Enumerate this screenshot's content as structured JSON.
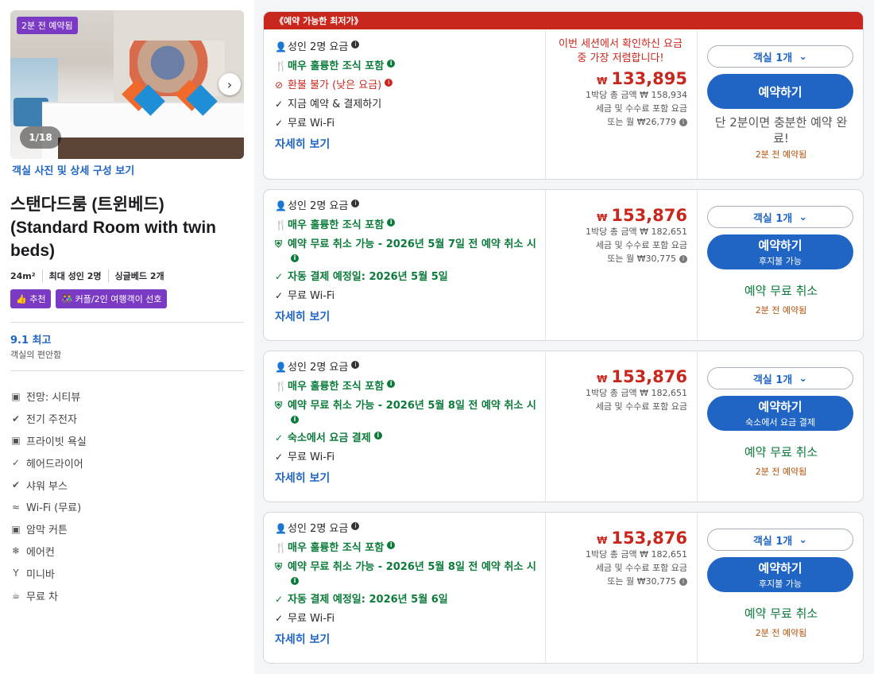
{
  "room": {
    "photo_badge": "2분 전 예약됨",
    "photo_count": "1/18",
    "photo_link": "객실 사진 및 상세 구성 보기",
    "title": "스탠다드룸 (트윈베드) (Standard Room with twin beds)",
    "specs": [
      "24m²",
      "최대 성인 2명",
      "싱글베드 2개"
    ],
    "tags": [
      "추천",
      "커플/2인 여행객이 선호"
    ],
    "rating": "9.1 최고",
    "rating_sub": "객실의 편안함",
    "amenities": [
      {
        "icon": "view-icon",
        "label": "전망: 시티뷰"
      },
      {
        "icon": "charger-icon",
        "label": "전기 주전자"
      },
      {
        "icon": "bathtub-icon",
        "label": "프라이빗 욕실"
      },
      {
        "icon": "check-icon",
        "label": "헤어드라이어"
      },
      {
        "icon": "shower-icon",
        "label": "샤워 부스"
      },
      {
        "icon": "wifi-icon",
        "label": "Wi-Fi (무료)"
      },
      {
        "icon": "curtain-icon",
        "label": "암막 커튼"
      },
      {
        "icon": "snowflake-icon",
        "label": "에어컨"
      },
      {
        "icon": "cocktail-icon",
        "label": "미니바"
      },
      {
        "icon": "tea-icon",
        "label": "무료 차"
      }
    ]
  },
  "offers": [
    {
      "banner": "《예약 가능한 최저가》",
      "features": [
        {
          "type": "person",
          "text": "성인 2명 요금"
        },
        {
          "type": "green",
          "icon": "fork-icon",
          "text": "매우 훌륭한 조식 포함"
        },
        {
          "type": "red",
          "icon": "no-icon",
          "text": "환불 불가 (낮은 요금)"
        },
        {
          "type": "plain",
          "icon": "check-icon",
          "text": "지금 예약 & 결제하기"
        },
        {
          "type": "plain",
          "icon": "check-icon",
          "text": "무료 Wi-Fi"
        }
      ],
      "details": "자세히 보기",
      "promo": "이번 세션에서 확인하신 요금 중 가장 저렴합니다!",
      "currency": "₩",
      "price": "133,895",
      "total": "1박당 총 금액 ₩ 158,934",
      "tax": "세금 및 수수료 포함 요금",
      "monthly": "또는 월 ₩26,779",
      "room_select": "객실 1개",
      "book_label": "예약하기",
      "book_sub": "",
      "free_cancel": "",
      "soon": "단 2분이면 충분한 예약 완료!",
      "recent": "2분 전 예약됨"
    },
    {
      "banner": "",
      "features": [
        {
          "type": "person",
          "text": "성인 2명 요금"
        },
        {
          "type": "green",
          "icon": "fork-icon",
          "text": "매우 훌륭한 조식 포함"
        },
        {
          "type": "green",
          "icon": "shield-icon",
          "text": "예약 무료 취소 가능 - 2026년 5월 7일 전 예약 취소 시"
        },
        {
          "type": "green",
          "icon": "check-icon",
          "text": "자동 결제 예정일: 2026년 5월 5일"
        },
        {
          "type": "plain",
          "icon": "check-icon",
          "text": "무료 Wi-Fi"
        }
      ],
      "details": "자세히 보기",
      "promo": "",
      "currency": "₩",
      "price": "153,876",
      "total": "1박당 총 금액 ₩ 182,651",
      "tax": "세금 및 수수료 포함 요금",
      "monthly": "또는 월 ₩30,775",
      "room_select": "객실 1개",
      "book_label": "예약하기",
      "book_sub": "후지불 가능",
      "free_cancel": "예약 무료 취소",
      "soon": "",
      "recent": "2분 전 예약됨"
    },
    {
      "banner": "",
      "features": [
        {
          "type": "person",
          "text": "성인 2명 요금"
        },
        {
          "type": "green",
          "icon": "fork-icon",
          "text": "매우 훌륭한 조식 포함"
        },
        {
          "type": "green",
          "icon": "shield-icon",
          "text": "예약 무료 취소 가능 - 2026년 5월 8일 전 예약 취소 시"
        },
        {
          "type": "green",
          "icon": "check-icon",
          "text": "숙소에서 요금 결제"
        },
        {
          "type": "plain",
          "icon": "check-icon",
          "text": "무료 Wi-Fi"
        }
      ],
      "details": "자세히 보기",
      "promo": "",
      "currency": "₩",
      "price": "153,876",
      "total": "1박당 총 금액 ₩ 182,651",
      "tax": "세금 및 수수료 포함 요금",
      "monthly": "",
      "room_select": "객실 1개",
      "book_label": "예약하기",
      "book_sub": "숙소에서 요금 결제",
      "free_cancel": "예약 무료 취소",
      "soon": "",
      "recent": "2분 전 예약됨"
    },
    {
      "banner": "",
      "features": [
        {
          "type": "person",
          "text": "성인 2명 요금"
        },
        {
          "type": "green",
          "icon": "fork-icon",
          "text": "매우 훌륭한 조식 포함"
        },
        {
          "type": "green",
          "icon": "shield-icon",
          "text": "예약 무료 취소 가능 - 2026년 5월 8일 전 예약 취소 시"
        },
        {
          "type": "green",
          "icon": "check-icon",
          "text": "자동 결제 예정일: 2026년 5월 6일"
        },
        {
          "type": "plain",
          "icon": "check-icon",
          "text": "무료 Wi-Fi"
        }
      ],
      "details": "자세히 보기",
      "promo": "",
      "currency": "₩",
      "price": "153,876",
      "total": "1박당 총 금액 ₩ 182,651",
      "tax": "세금 및 수수료 포함 요금",
      "monthly": "또는 월 ₩30,775",
      "room_select": "객실 1개",
      "book_label": "예약하기",
      "book_sub": "후지불 가능",
      "free_cancel": "예약 무료 취소",
      "soon": "",
      "recent": "2분 전 예약됨"
    }
  ],
  "colors": {
    "accent": "#2065c4",
    "price": "#c8271d",
    "green": "#0c7a3a",
    "badge": "#7b3ac4"
  }
}
